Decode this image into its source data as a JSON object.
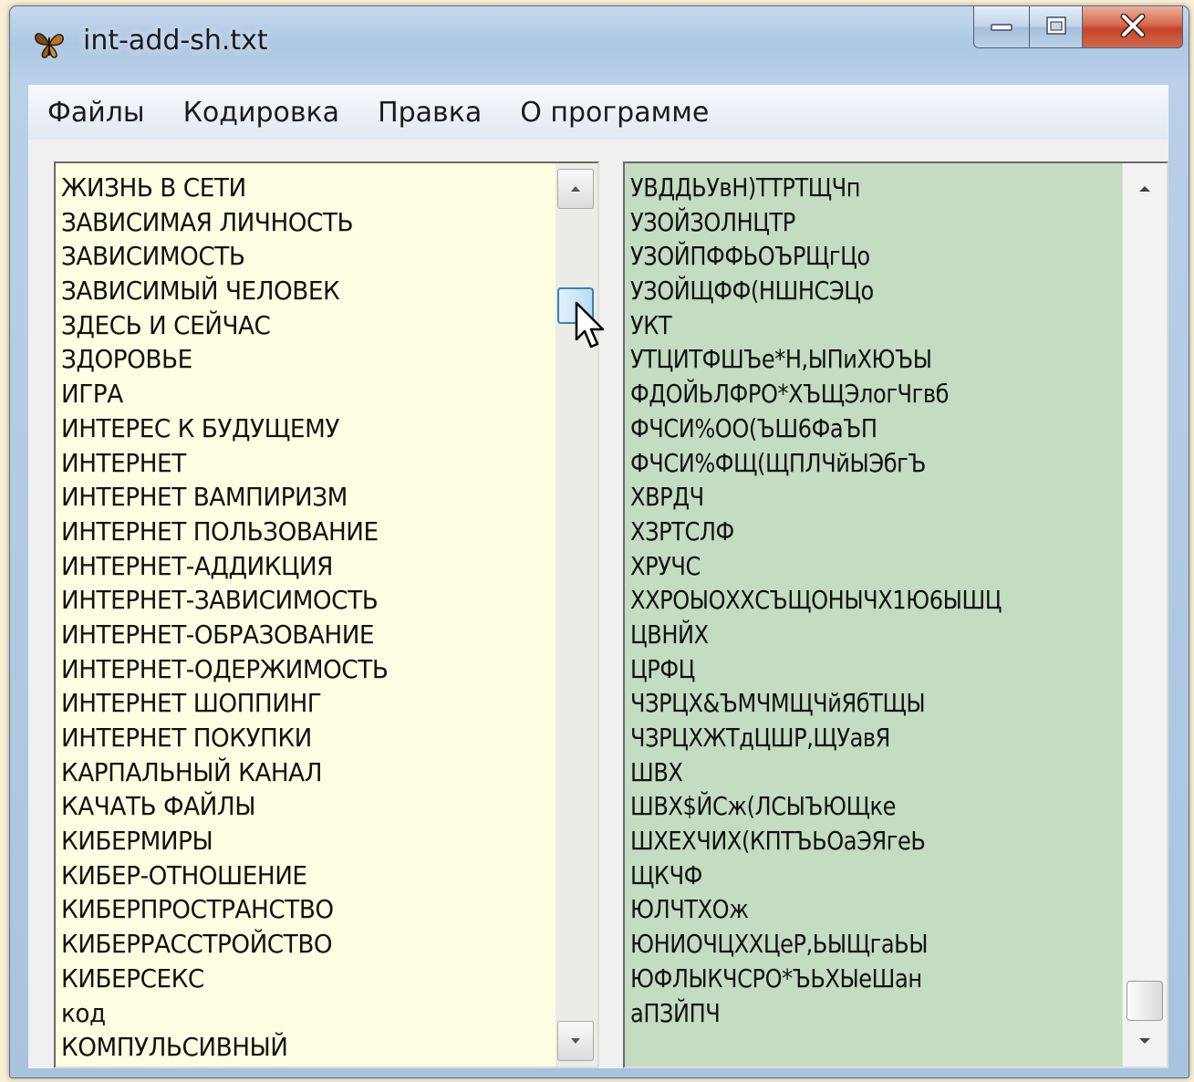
{
  "window": {
    "title": "int-add-sh.txt"
  },
  "menu": [
    {
      "label": "Файлы"
    },
    {
      "label": "Кодировка"
    },
    {
      "label": "Правка"
    },
    {
      "label": "О программе"
    }
  ],
  "left_list": {
    "items": [
      "ЖИЗНЬ В СЕТИ",
      "ЗАВИСИМАЯ ЛИЧНОСТЬ",
      "ЗАВИСИМОСТЬ",
      "ЗАВИСИМЫЙ ЧЕЛОВЕК",
      "ЗДЕСЬ И СЕЙЧАС",
      "ЗДОРОВЬЕ",
      "ИГРА",
      "ИНТЕРЕС К БУДУЩЕМУ",
      "ИНТЕРНЕТ",
      "ИНТЕРНЕТ ВАМПИРИЗМ",
      "ИНТЕРНЕТ ПОЛЬЗОВАНИЕ",
      "ИНТЕРНЕТ-АДДИКЦИЯ",
      "ИНТЕРНЕТ-ЗАВИСИМОСТЬ",
      "ИНТЕРНЕТ-ОБРАЗОВАНИЕ",
      "ИНТЕРНЕТ-ОДЕРЖИМОСТЬ",
      "ИНТЕРНЕТ ШОППИНГ",
      "ИНТЕРНЕТ ПОКУПКИ",
      "КАРПАЛЬНЫЙ КАНАЛ",
      "КАЧАТЬ ФАЙЛЫ",
      "КИБЕРМИРЫ",
      "КИБЕР-ОТНОШЕНИЕ",
      "КИБЕРПРОСТРАНСТВО",
      "КИБЕРРАССТРОЙСТВО",
      "КИБЕРСЕКС",
      "код",
      "КОМПУЛЬСИВНЫЙ"
    ],
    "scroll_position": 0.12
  },
  "right_list": {
    "items": [
      "УВДДЬУвН)ТТРТЩЧп",
      "УЗОЙЗОЛНЦТР",
      "УЗОЙПФФЬОЪРЩгЦо",
      "УЗОЙЩФФ(НШНСЭЦо",
      "УКТ",
      "УТЦИТФШЪе*Н,ЫПиХЮЪЫ",
      "ФДОЙЬЛФРО*ХЪЩЭлогЧгвб",
      "ФЧСИ%ОО(ЪШ6ФаЪП",
      "ФЧСИ%ФЩ(ЩПЛЧйЫЭбгЪ",
      "ХВРДЧ",
      "ХЗРТСЛФ",
      "ХРУЧС",
      "ХХРОЫОХХСЪЩОНЫЧХ1Ю6ЫШЦ",
      "ЦВНЙХ",
      "ЦРФЦ",
      "ЧЗРЦХ&ЪМЧМЩЧйЯбТЩЫ",
      "ЧЗРЦХЖТдЦШР,ЩУавЯ",
      "ШВХ",
      "ШВХ$ЙСж(ЛСЫЪЮЩке",
      "ШХЕХЧИХ(КПТЪЬОаЭЯгеЬ",
      "ЩКЧФ",
      "ЮЛЧТХОж",
      "ЮНИОЧЦХХЦеР,ЬЫЩгаЬЫ",
      "ЮФЛЫКЧСРО*ЪЬХЫеШан",
      "аПЗЙПЧ"
    ],
    "scroll_position": 0.95
  },
  "colors": {
    "left_list_bg": "#fffee2",
    "right_list_bg": "#c3dcc2",
    "close_button": "#c3432a",
    "page_bg": "#fbeed6"
  },
  "icons": {
    "app": "butterfly-icon",
    "minimize": "minimize-icon",
    "maximize": "maximize-icon",
    "close": "close-icon",
    "cursor": "mouse-pointer-icon"
  }
}
